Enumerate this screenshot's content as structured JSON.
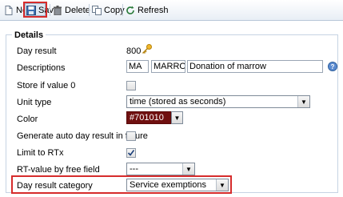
{
  "toolbar": {
    "new_label": "New",
    "save_label": "Save",
    "delete_label": "Delete",
    "copy_label": "Copy",
    "refresh_label": "Refresh"
  },
  "details": {
    "legend": "Details",
    "day_result": {
      "label": "Day result",
      "value": "800"
    },
    "descriptions": {
      "label": "Descriptions",
      "short": "MA",
      "code": "MARROW",
      "text": "Donation of marrow"
    },
    "store_if_zero": {
      "label": "Store if value 0",
      "checked": false
    },
    "unit_type": {
      "label": "Unit type",
      "selected": "time (stored as seconds)"
    },
    "color": {
      "label": "Color",
      "value": "#701010",
      "swatch": "#701010"
    },
    "generate_auto": {
      "label": "Generate auto day result in future",
      "checked": false
    },
    "limit_rtx": {
      "label": "Limit to RTx",
      "checked": true
    },
    "rt_value": {
      "label": "RT-value by free field",
      "selected": "---"
    },
    "day_result_category": {
      "label": "Day result category",
      "selected": "Service exemptions"
    }
  },
  "colors": {
    "highlight": "#d62c2c",
    "accent": "#1a5fb4"
  }
}
